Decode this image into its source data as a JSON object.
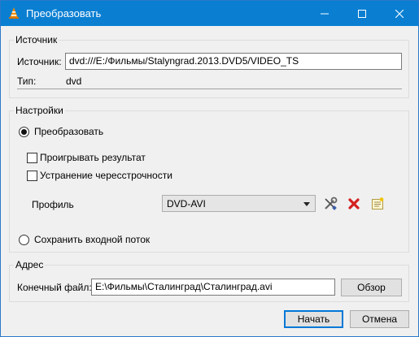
{
  "window": {
    "title": "Преобразовать",
    "icons": {
      "app": "vlc-cone-icon",
      "minimize": "minimize-icon",
      "maximize": "maximize-icon",
      "close": "close-icon"
    }
  },
  "source": {
    "group_title": "Источник",
    "source_label": "Источник:",
    "source_value": "dvd:///E:/Фильмы/Stalyngrad.2013.DVD5/VIDEO_TS",
    "type_label": "Тип:",
    "type_value": "dvd"
  },
  "settings": {
    "group_title": "Настройки",
    "convert_label": "Преобразовать",
    "convert_checked": true,
    "play_result_label": "Проигрывать результат",
    "play_result_checked": false,
    "deinterlace_label": "Устранение чересстрочности",
    "deinterlace_checked": false,
    "profile_label": "Профиль",
    "profile_value": "DVD-AVI",
    "profile_icons": {
      "edit": "wrench-screwdriver-icon",
      "delete": "delete-x-icon",
      "new": "new-profile-icon"
    },
    "dump_label": "Сохранить входной поток",
    "dump_checked": false
  },
  "destination": {
    "group_title": "Адрес",
    "file_label": "Конечный файл:",
    "file_value": "E:\\Фильмы\\Сталинград\\Сталинград.avi",
    "browse_label": "Обзор"
  },
  "footer": {
    "start_label": "Начать",
    "cancel_label": "Отмена"
  },
  "colors": {
    "titlebar": "#0a7fd2",
    "accent": "#0078d7",
    "vlc_orange": "#f48b00",
    "delete_red": "#d42020"
  }
}
